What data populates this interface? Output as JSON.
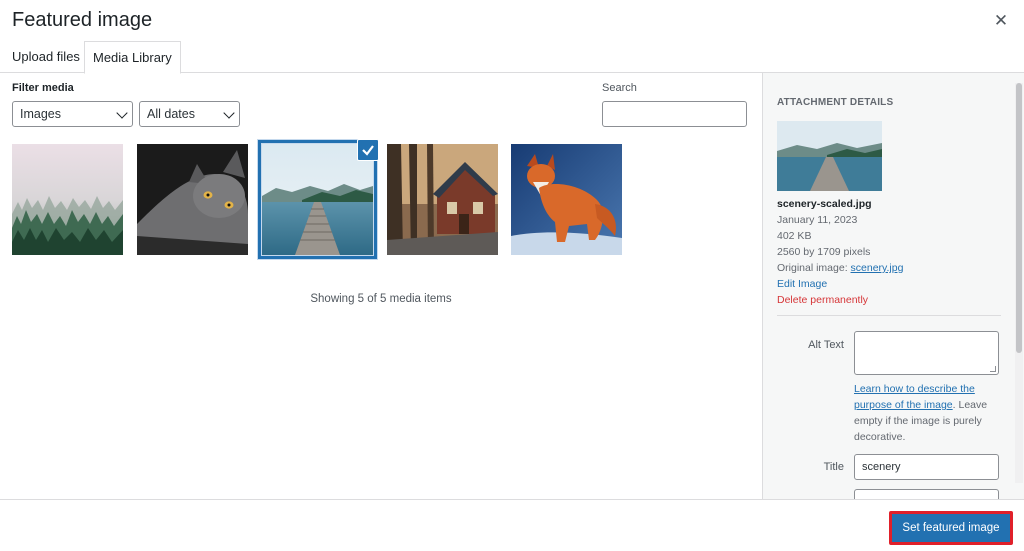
{
  "modal": {
    "title": "Featured image"
  },
  "tabs": [
    {
      "label": "Upload files"
    },
    {
      "label": "Media Library"
    }
  ],
  "filters": {
    "label": "Filter media",
    "type_selected": "Images",
    "date_selected": "All dates"
  },
  "search": {
    "label": "Search",
    "value": ""
  },
  "media_items": [
    {
      "icon": "misty-forest-image"
    },
    {
      "icon": "cat-image"
    },
    {
      "icon": "lake-pier-image",
      "selected": true
    },
    {
      "icon": "cabin-image"
    },
    {
      "icon": "fox-image"
    }
  ],
  "media_count": "Showing 5 of 5 media items",
  "attachment": {
    "heading": "ATTACHMENT DETAILS",
    "filename": "scenery-scaled.jpg",
    "date": "January 11, 2023",
    "size": "402 KB",
    "dimensions": "2560 by 1709 pixels",
    "original_prefix": "Original image: ",
    "original_link": "scenery.jpg",
    "edit_label": "Edit Image",
    "delete_label": "Delete permanently",
    "alt_label": "Alt Text",
    "alt_value": "",
    "alt_help_link": "Learn how to describe the purpose of the image",
    "alt_help_text": ". Leave empty if the image is purely decorative.",
    "title_label": "Title",
    "title_value": "scenery"
  },
  "footer": {
    "button_label": "Set featured image"
  },
  "colors": {
    "accent": "#2271b1",
    "danger": "#d63638",
    "highlight": "#e0202a"
  }
}
